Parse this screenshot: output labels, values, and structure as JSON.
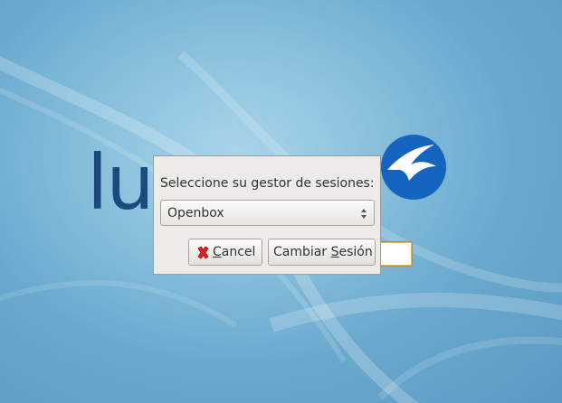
{
  "desktop": {
    "brand_text": "lu",
    "logo_icon": "lubuntu-bird-logo",
    "colors": {
      "background": "#7ab8da",
      "brand_text": "#1b4a7c",
      "logo_circle": "#1565c0"
    }
  },
  "login": {
    "password_value": ""
  },
  "session_dialog": {
    "prompt": "Seleccione su gestor de sesiones:",
    "selected_session": "Openbox",
    "cancel_icon": "red-x-cancel-icon",
    "cancel_mnemonic": "C",
    "cancel_rest": "ancel",
    "switch_prefix": "Cambiar ",
    "switch_mnemonic": "S",
    "switch_rest": "esión"
  }
}
